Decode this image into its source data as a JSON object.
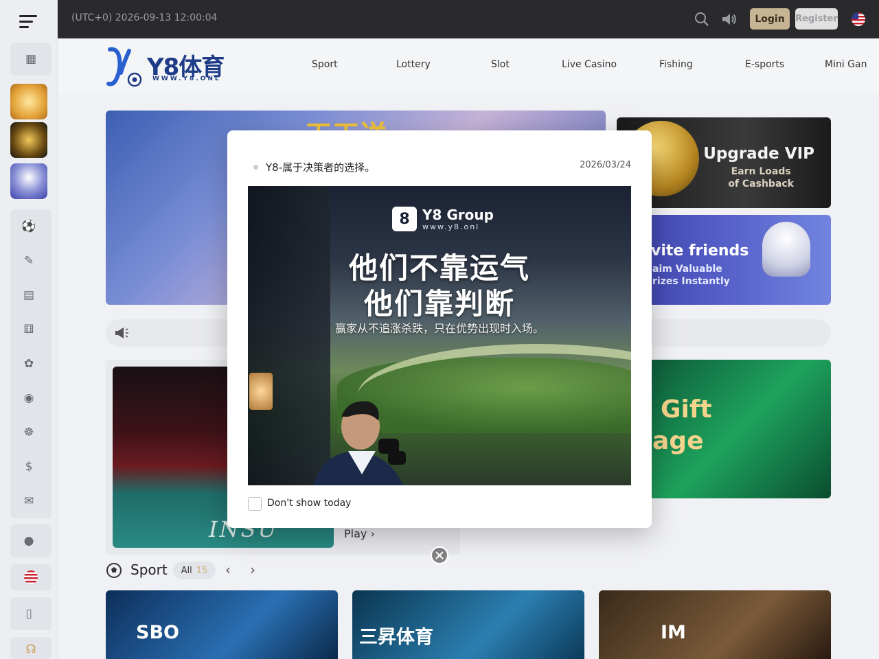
{
  "topbar": {
    "clock": "(UTC+0) 2026-09-13 12:00:04",
    "login_label": "Login",
    "register_label": "Register",
    "icons": [
      "menu-icon",
      "search-icon",
      "sound-icon",
      "us-flag-icon"
    ]
  },
  "logo": {
    "main": "Y8体育",
    "sub": "WWW.Y8.ONL"
  },
  "nav": {
    "items": [
      {
        "label": "Sport"
      },
      {
        "label": "Lottery"
      },
      {
        "label": "Slot"
      },
      {
        "label": "Live Casino"
      },
      {
        "label": "Fishing"
      },
      {
        "label": "E-sports"
      },
      {
        "label": "Mini Gan"
      }
    ]
  },
  "sidebar": {
    "icons": [
      "gift-box-icon",
      "soccer-ball-icon",
      "lottery-ticket-icon",
      "slot-icon",
      "dice-icon",
      "fishing-icon",
      "gamepad-icon",
      "mini-game-icon",
      "dollar-icon",
      "ticket-icon",
      "user-icon",
      "us-flag-icon",
      "phone-icon",
      "headset-icon"
    ]
  },
  "banner": {
    "text": "天天送"
  },
  "promos": {
    "vip_title": "Upgrade VIP",
    "vip_sub_line1": "Earn Loads",
    "vip_sub_line2": "of Cashback",
    "invite_title": "vite friends",
    "invite_sub_line1": "aim Valuable",
    "invite_sub_line2": "rizes Instantly",
    "gift_line1": "Gift",
    "gift_line2": "age"
  },
  "casino": {
    "table_text": "INSU",
    "play_label": "Play"
  },
  "sport_section": {
    "title": "Sport",
    "all_label": "All",
    "all_count": "15"
  },
  "providers": [
    {
      "name": "SBO"
    },
    {
      "name": "三昇体育"
    },
    {
      "name": "IM"
    }
  ],
  "modal": {
    "title": "Y8-属于决策者的选择。",
    "date": "2026/03/24",
    "image": {
      "brand": "Y8 Group",
      "url": "www.y8.onl",
      "line1": "他们不靠运气",
      "line2": "他们靠判断",
      "line3": "赢家从不追涨杀跌，只在优势出现时入场。"
    },
    "checkbox_label": "Don't show today",
    "checkbox_checked": false
  },
  "colors": {
    "topbar_bg": "#2a2a2c",
    "login_bg": "#c7b494",
    "register_bg": "#e1e1e1",
    "brand_blue": "#1e3b87",
    "count_gold": "#d0b37a"
  }
}
